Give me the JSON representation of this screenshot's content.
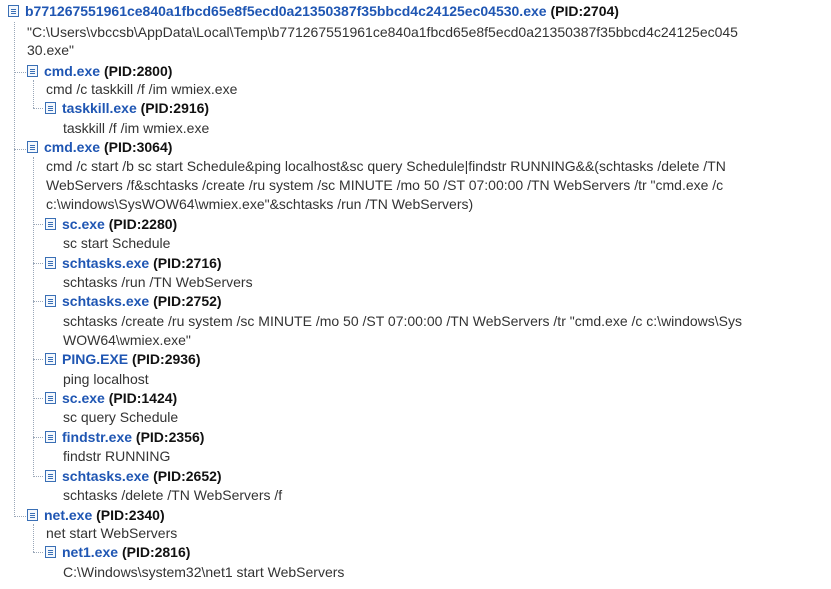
{
  "root": {
    "name": "b771267551961ce840a1fbcd65e8f5ecd0a21350387f35bbcd4c24125ec04530.exe",
    "pid": "(PID:2704)",
    "cmd": [
      "\"C:\\Users\\vbccsb\\AppData\\Local\\Temp\\b771267551961ce840a1fbcd65e8f5ecd0a21350387f35bbcd4c24125ec045",
      "30.exe\""
    ]
  },
  "cmd1": {
    "name": "cmd.exe",
    "pid": "(PID:2800)",
    "cmd": [
      "cmd /c taskkill /f /im wmiex.exe"
    ]
  },
  "taskkill": {
    "name": "taskkill.exe",
    "pid": "(PID:2916)",
    "cmd": [
      "taskkill /f /im wmiex.exe"
    ]
  },
  "cmd2": {
    "name": "cmd.exe",
    "pid": "(PID:3064)",
    "cmd": [
      "cmd /c start /b sc start Schedule&ping localhost&sc query Schedule|findstr RUNNING&&(schtasks /delete /TN",
      "WebServers /f&schtasks /create /ru system /sc MINUTE /mo 50 /ST 07:00:00 /TN WebServers /tr \"cmd.exe /c",
      "c:\\windows\\SysWOW64\\wmiex.exe\"&schtasks /run /TN WebServers)"
    ]
  },
  "sc1": {
    "name": "sc.exe",
    "pid": "(PID:2280)",
    "cmd": [
      "sc start Schedule"
    ]
  },
  "schtasks1": {
    "name": "schtasks.exe",
    "pid": "(PID:2716)",
    "cmd": [
      "schtasks /run /TN WebServers"
    ]
  },
  "schtasks2": {
    "name": "schtasks.exe",
    "pid": "(PID:2752)",
    "cmd": [
      "schtasks /create /ru system /sc MINUTE /mo 50 /ST 07:00:00 /TN WebServers /tr \"cmd.exe /c c:\\windows\\Sys",
      "WOW64\\wmiex.exe\""
    ]
  },
  "ping": {
    "name": "PING.EXE",
    "pid": "(PID:2936)",
    "cmd": [
      "ping localhost"
    ]
  },
  "sc2": {
    "name": "sc.exe",
    "pid": "(PID:1424)",
    "cmd": [
      "sc query Schedule"
    ]
  },
  "findstr": {
    "name": "findstr.exe",
    "pid": "(PID:2356)",
    "cmd": [
      "findstr RUNNING"
    ]
  },
  "schtasks3": {
    "name": "schtasks.exe",
    "pid": "(PID:2652)",
    "cmd": [
      "schtasks /delete /TN WebServers /f"
    ]
  },
  "net": {
    "name": "net.exe",
    "pid": "(PID:2340)",
    "cmd": [
      "net start WebServers"
    ]
  },
  "net1": {
    "name": "net1.exe",
    "pid": "(PID:2816)",
    "cmd": [
      "C:\\Windows\\system32\\net1 start WebServers"
    ]
  }
}
